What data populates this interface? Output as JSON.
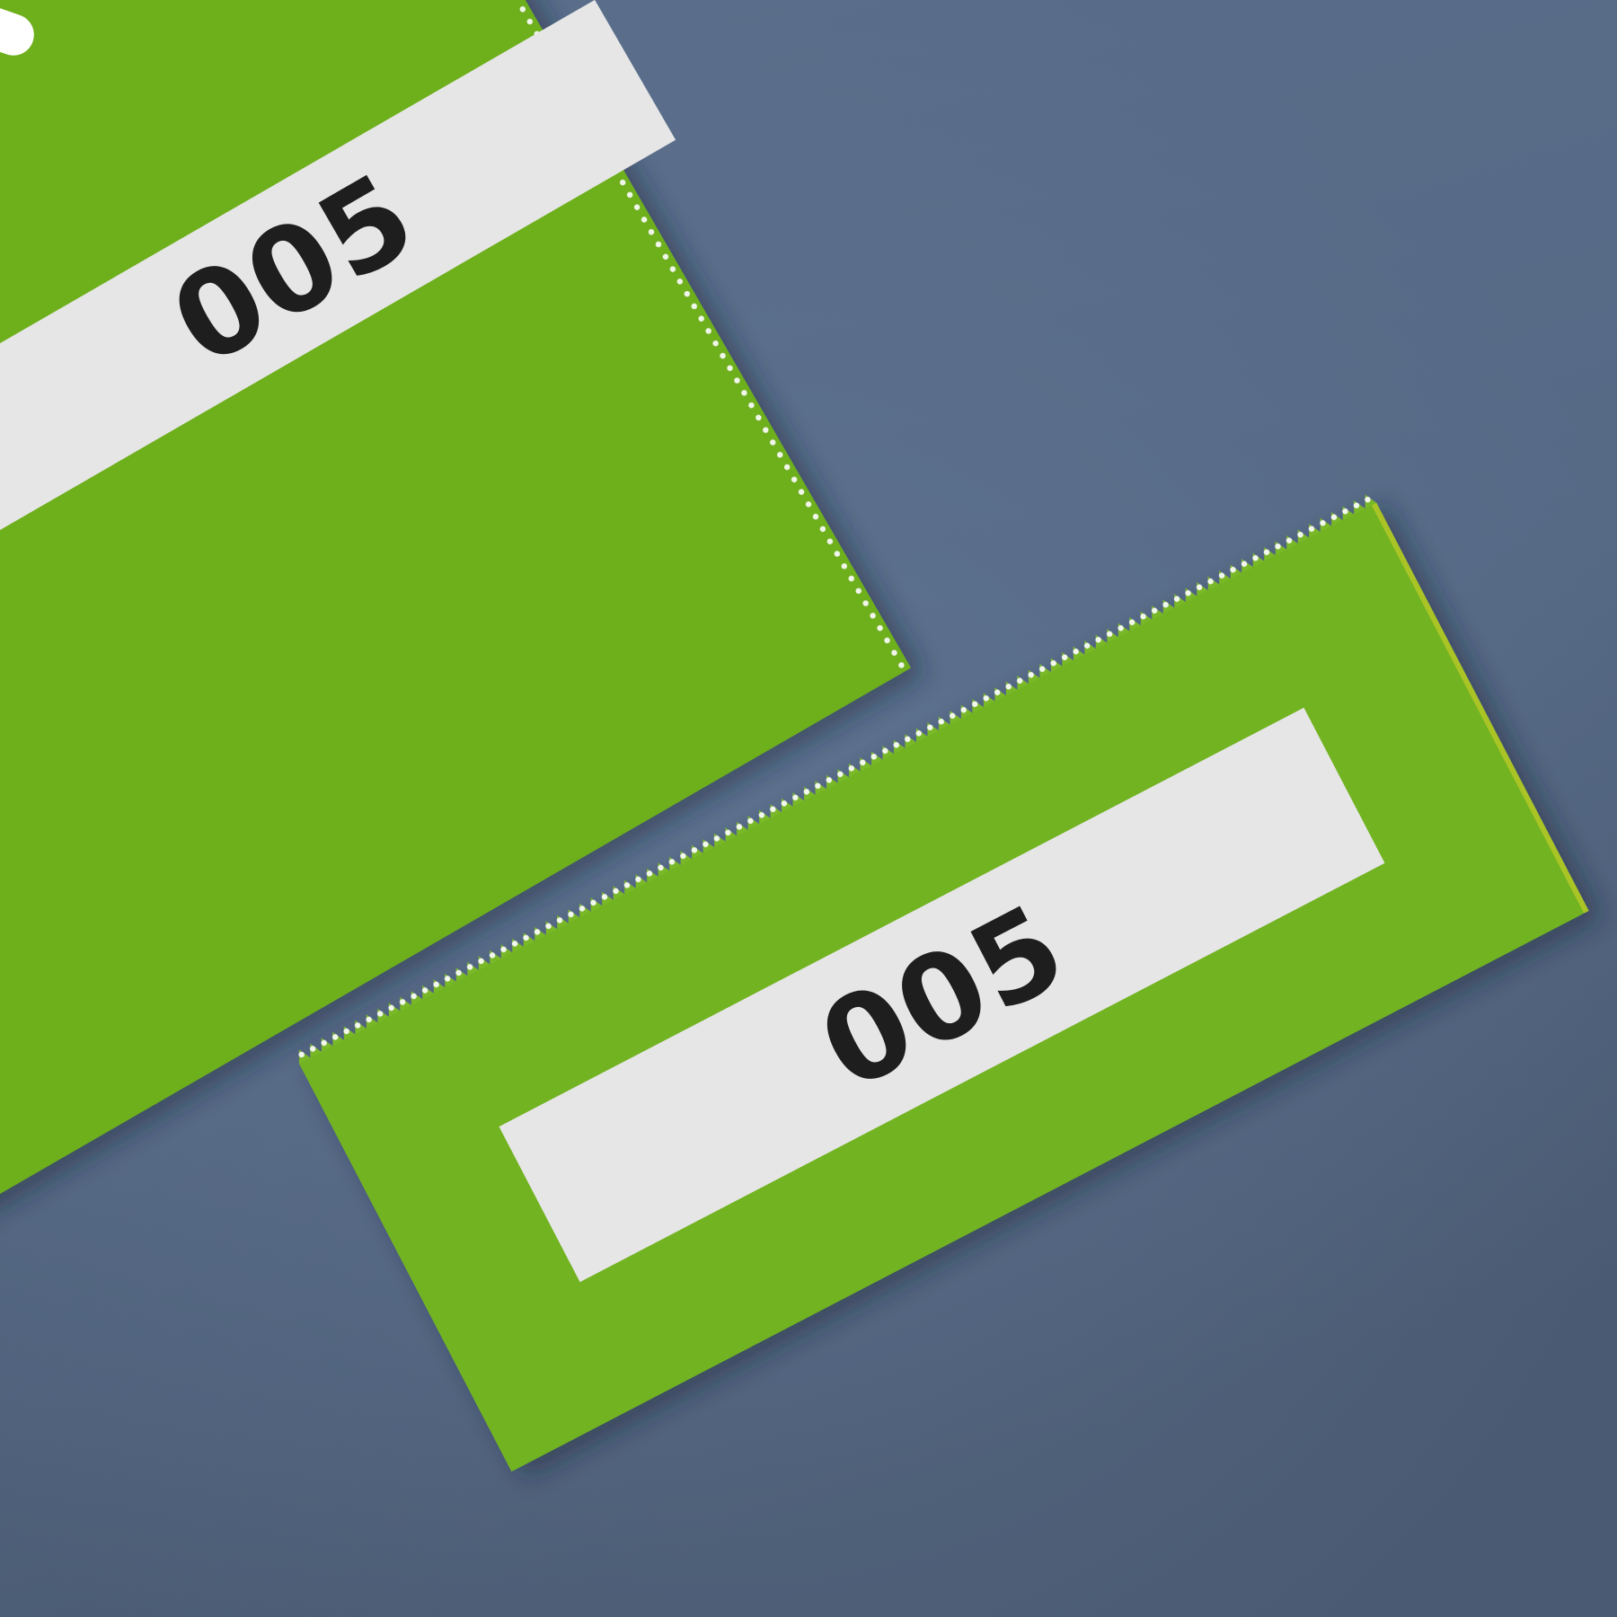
{
  "scene": {
    "background_color": "#566a86",
    "background_color_dark": "#4a5a72",
    "paper_color": "#6eaf1c",
    "paper_color_light": "#79b828",
    "label_color": "#e6e6e6",
    "ink_color": "#1e1e1e",
    "perforation_color": "#ffffff"
  },
  "ticket_stub": {
    "number": "005",
    "icons": [
      "chevron-graphic",
      "dot-graphic"
    ]
  },
  "ticket_torn": {
    "number": "005"
  }
}
